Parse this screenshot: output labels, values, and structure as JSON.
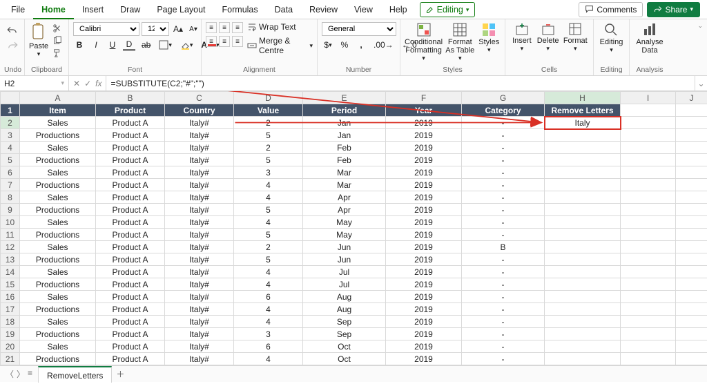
{
  "tabs": {
    "file": "File",
    "home": "Home",
    "insert": "Insert",
    "draw": "Draw",
    "page_layout": "Page Layout",
    "formulas": "Formulas",
    "data": "Data",
    "review": "Review",
    "view": "View",
    "help": "Help",
    "editing": "Editing"
  },
  "titlebar": {
    "comments": "Comments",
    "share": "Share"
  },
  "ribbon": {
    "undo": "Undo",
    "clipboard": {
      "title": "Clipboard",
      "paste": "Paste"
    },
    "font": {
      "title": "Font",
      "name": "Calibri",
      "size": "12"
    },
    "alignment": {
      "title": "Alignment",
      "wrap": "Wrap Text",
      "merge": "Merge & Centre"
    },
    "number": {
      "title": "Number",
      "format": "General"
    },
    "styles": {
      "title": "Styles",
      "cond": "Conditional Formatting",
      "fmt_tbl": "Format As Table",
      "styles": "Styles"
    },
    "cells": {
      "title": "Cells",
      "insert": "Insert",
      "delete": "Delete",
      "format": "Format"
    },
    "editing": {
      "title": "Editing",
      "editing": "Editing"
    },
    "analysis": {
      "title": "Analysis",
      "analyse": "Analyse Data"
    }
  },
  "fbar": {
    "name": "H2",
    "formula": "=SUBSTITUTE(C2;\"#\";\"\")"
  },
  "columns": [
    "A",
    "B",
    "C",
    "D",
    "E",
    "F",
    "G",
    "H",
    "I",
    "J"
  ],
  "headers": {
    "A": "Item",
    "B": "Product",
    "C": "Country",
    "D": "Value",
    "E": "Period",
    "F": "Year",
    "G": "Category",
    "H": "Remove Letters"
  },
  "rows": [
    {
      "n": 2,
      "A": "Sales",
      "B": "Product A",
      "C": "Italy#",
      "D": "2",
      "E": "Jan",
      "F": "2019",
      "G": "-",
      "H": "Italy"
    },
    {
      "n": 3,
      "A": "Productions",
      "B": "Product A",
      "C": "Italy#",
      "D": "5",
      "E": "Jan",
      "F": "2019",
      "G": "-",
      "H": ""
    },
    {
      "n": 4,
      "A": "Sales",
      "B": "Product A",
      "C": "Italy#",
      "D": "2",
      "E": "Feb",
      "F": "2019",
      "G": "-",
      "H": ""
    },
    {
      "n": 5,
      "A": "Productions",
      "B": "Product A",
      "C": "Italy#",
      "D": "5",
      "E": "Feb",
      "F": "2019",
      "G": "-",
      "H": ""
    },
    {
      "n": 6,
      "A": "Sales",
      "B": "Product A",
      "C": "Italy#",
      "D": "3",
      "E": "Mar",
      "F": "2019",
      "G": "-",
      "H": ""
    },
    {
      "n": 7,
      "A": "Productions",
      "B": "Product A",
      "C": "Italy#",
      "D": "4",
      "E": "Mar",
      "F": "2019",
      "G": "-",
      "H": ""
    },
    {
      "n": 8,
      "A": "Sales",
      "B": "Product A",
      "C": "Italy#",
      "D": "4",
      "E": "Apr",
      "F": "2019",
      "G": "-",
      "H": ""
    },
    {
      "n": 9,
      "A": "Productions",
      "B": "Product A",
      "C": "Italy#",
      "D": "5",
      "E": "Apr",
      "F": "2019",
      "G": "-",
      "H": ""
    },
    {
      "n": 10,
      "A": "Sales",
      "B": "Product A",
      "C": "Italy#",
      "D": "4",
      "E": "May",
      "F": "2019",
      "G": "-",
      "H": ""
    },
    {
      "n": 11,
      "A": "Productions",
      "B": "Product A",
      "C": "Italy#",
      "D": "5",
      "E": "May",
      "F": "2019",
      "G": "-",
      "H": ""
    },
    {
      "n": 12,
      "A": "Sales",
      "B": "Product A",
      "C": "Italy#",
      "D": "2",
      "E": "Jun",
      "F": "2019",
      "G": "B",
      "H": ""
    },
    {
      "n": 13,
      "A": "Productions",
      "B": "Product A",
      "C": "Italy#",
      "D": "5",
      "E": "Jun",
      "F": "2019",
      "G": "-",
      "H": ""
    },
    {
      "n": 14,
      "A": "Sales",
      "B": "Product A",
      "C": "Italy#",
      "D": "4",
      "E": "Jul",
      "F": "2019",
      "G": "-",
      "H": ""
    },
    {
      "n": 15,
      "A": "Productions",
      "B": "Product A",
      "C": "Italy#",
      "D": "4",
      "E": "Jul",
      "F": "2019",
      "G": "-",
      "H": ""
    },
    {
      "n": 16,
      "A": "Sales",
      "B": "Product A",
      "C": "Italy#",
      "D": "6",
      "E": "Aug",
      "F": "2019",
      "G": "-",
      "H": ""
    },
    {
      "n": 17,
      "A": "Productions",
      "B": "Product A",
      "C": "Italy#",
      "D": "4",
      "E": "Aug",
      "F": "2019",
      "G": "-",
      "H": ""
    },
    {
      "n": 18,
      "A": "Sales",
      "B": "Product A",
      "C": "Italy#",
      "D": "4",
      "E": "Sep",
      "F": "2019",
      "G": "-",
      "H": ""
    },
    {
      "n": 19,
      "A": "Productions",
      "B": "Product A",
      "C": "Italy#",
      "D": "3",
      "E": "Sep",
      "F": "2019",
      "G": "-",
      "H": ""
    },
    {
      "n": 20,
      "A": "Sales",
      "B": "Product A",
      "C": "Italy#",
      "D": "6",
      "E": "Oct",
      "F": "2019",
      "G": "-",
      "H": ""
    },
    {
      "n": 21,
      "A": "Productions",
      "B": "Product A",
      "C": "Italy#",
      "D": "4",
      "E": "Oct",
      "F": "2019",
      "G": "-",
      "H": ""
    }
  ],
  "sheets": {
    "name": "RemoveLetters"
  },
  "active": {
    "cell": "H2",
    "row": 2,
    "col": "H"
  }
}
